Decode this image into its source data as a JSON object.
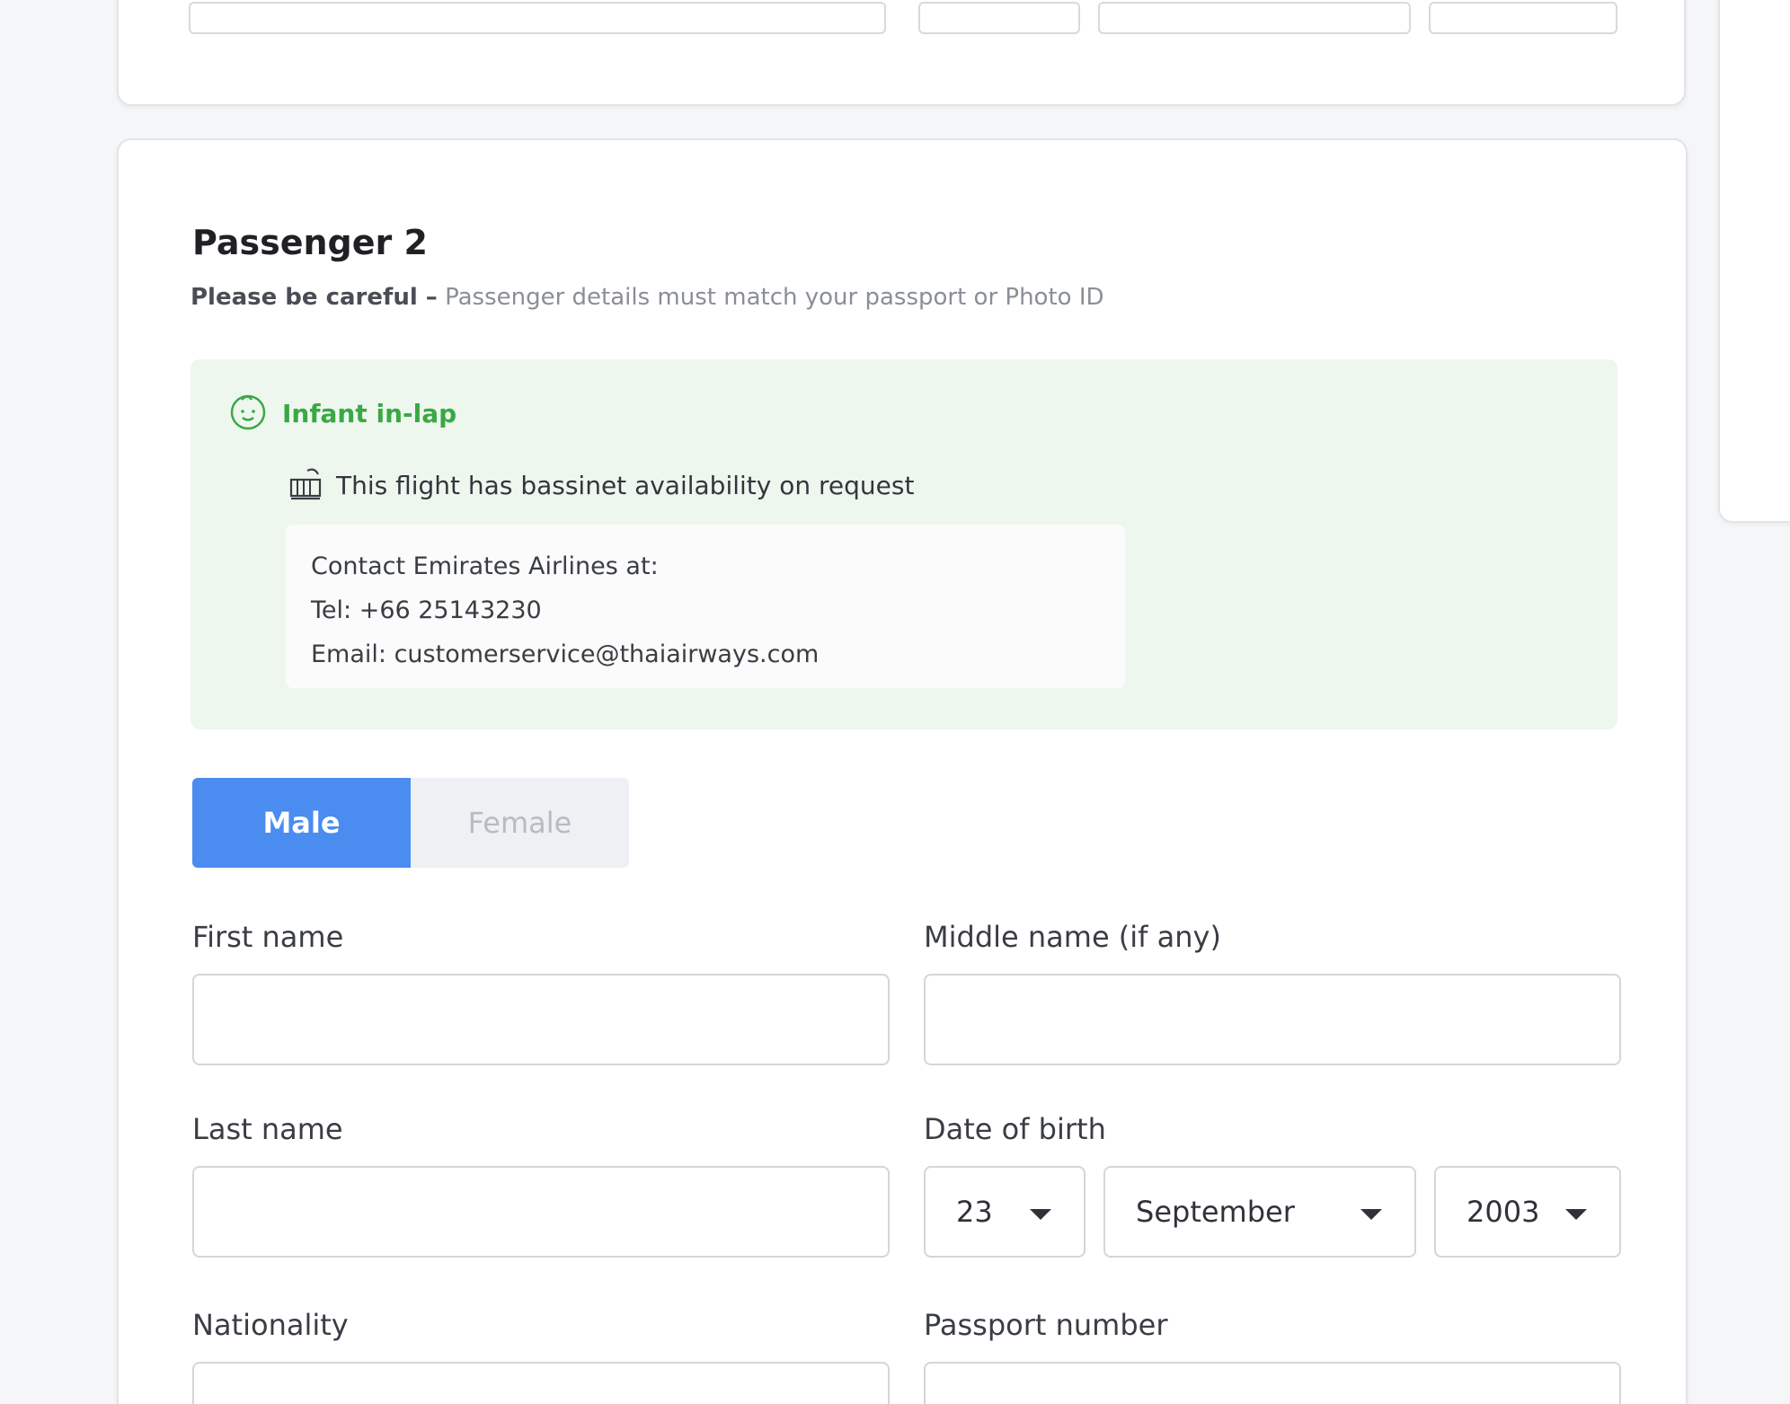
{
  "passenger": {
    "title": "Passenger 2",
    "notice_lead": "Please be careful –",
    "notice_text": " Passenger details must match your passport or Photo ID"
  },
  "infant": {
    "label": "Infant in-lap",
    "icon": "baby-face-icon",
    "bassinet_icon": "bassinet-icon",
    "bassinet_text": "This flight has bassinet availability on request",
    "contact": {
      "heading": "Contact Emirates Airlines at:",
      "tel": "Tel: +66 25143230",
      "email": "Email: customerservice@thaiairways.com"
    }
  },
  "gender": {
    "male": "Male",
    "female": "Female",
    "selected": "Male"
  },
  "fields": {
    "first_name_label": "First name",
    "middle_name_label": "Middle name (if any)",
    "last_name_label": "Last name",
    "dob_label": "Date of birth",
    "dob_day": "23",
    "dob_month": "September",
    "dob_year": "2003",
    "nationality_label": "Nationality",
    "passport_label": "Passport number"
  },
  "colors": {
    "primary": "#4a8cf0",
    "infant_green": "#3aa845",
    "infant_bg": "#eef7ee"
  }
}
